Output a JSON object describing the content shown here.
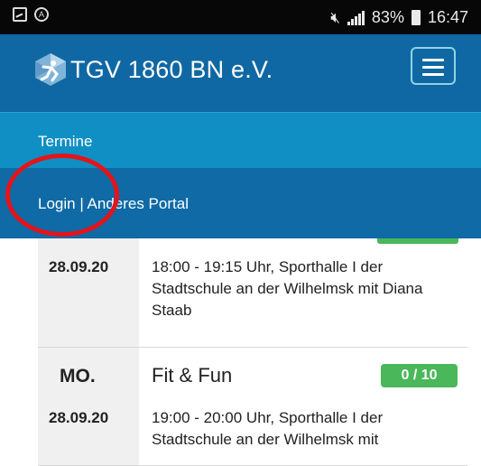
{
  "status_bar": {
    "battery": "83%",
    "time": "16:47",
    "icons": [
      "image-icon",
      "alarm-icon",
      "mute-icon",
      "signal-icon",
      "battery-icon"
    ]
  },
  "header": {
    "title": "TGV 1860 BN e.V.",
    "menu_icon": "hamburger-icon",
    "brand_color": "#0f68a3"
  },
  "nav": {
    "termine": "Termine",
    "login": "Login | Anderes Portal"
  },
  "events": [
    {
      "date": "28.09.20",
      "description": "18:00 - 19:15 Uhr, Sporthalle I der Stadtschule an der Wilhelmsk mit Diana Staab"
    },
    {
      "weekday": "MO.",
      "date": "28.09.20",
      "title": "Fit & Fun",
      "badge": "0 / 10",
      "description": "19:00 - 20:00 Uhr, Sporthalle I der Stadtschule an der Wilhelmsk mit"
    }
  ],
  "colors": {
    "nav_termine": "#0f8fc3",
    "nav_login": "#0f6aa6",
    "badge_green": "#49b75a",
    "annotation_red": "#e4141b"
  }
}
